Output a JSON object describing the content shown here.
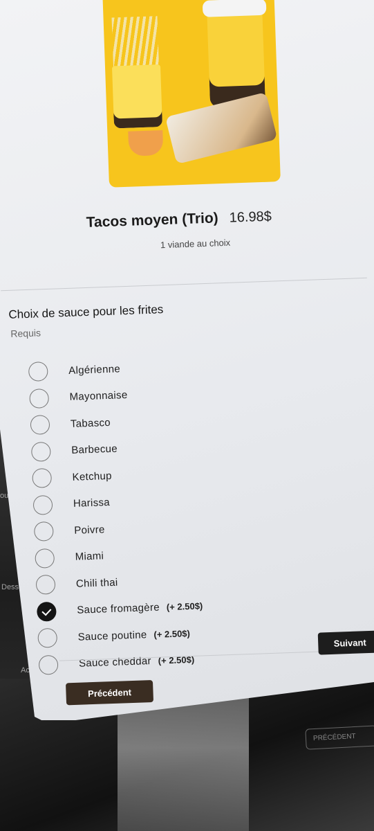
{
  "product": {
    "title": "Tacos moyen (Trio)",
    "price": "16.98$",
    "subtitle": "1 viande au choix"
  },
  "section": {
    "title": "Choix de sauce pour les frites",
    "required_label": "Requis"
  },
  "options": [
    {
      "label": "Algérienne",
      "extra": "",
      "selected": false
    },
    {
      "label": "Mayonnaise",
      "extra": "",
      "selected": false
    },
    {
      "label": "Tabasco",
      "extra": "",
      "selected": false
    },
    {
      "label": "Barbecue",
      "extra": "",
      "selected": false
    },
    {
      "label": "Ketchup",
      "extra": "",
      "selected": false
    },
    {
      "label": "Harissa",
      "extra": "",
      "selected": false
    },
    {
      "label": "Poivre",
      "extra": "",
      "selected": false
    },
    {
      "label": "Miami",
      "extra": "",
      "selected": false
    },
    {
      "label": "Chili thai",
      "extra": "",
      "selected": false
    },
    {
      "label": "Sauce fromagère",
      "extra": "(+ 2.50$)",
      "selected": true
    },
    {
      "label": "Sauce poutine",
      "extra": "(+ 2.50$)",
      "selected": false
    },
    {
      "label": "Sauce cheddar",
      "extra": "(+ 2.50$)",
      "selected": false
    }
  ],
  "buttons": {
    "next": "Suivant",
    "previous": "Précédent"
  },
  "background": {
    "ghost_prev": "PRÉCÉDENT",
    "side_labels": [
      "out",
      "Dess",
      "Ac"
    ]
  }
}
